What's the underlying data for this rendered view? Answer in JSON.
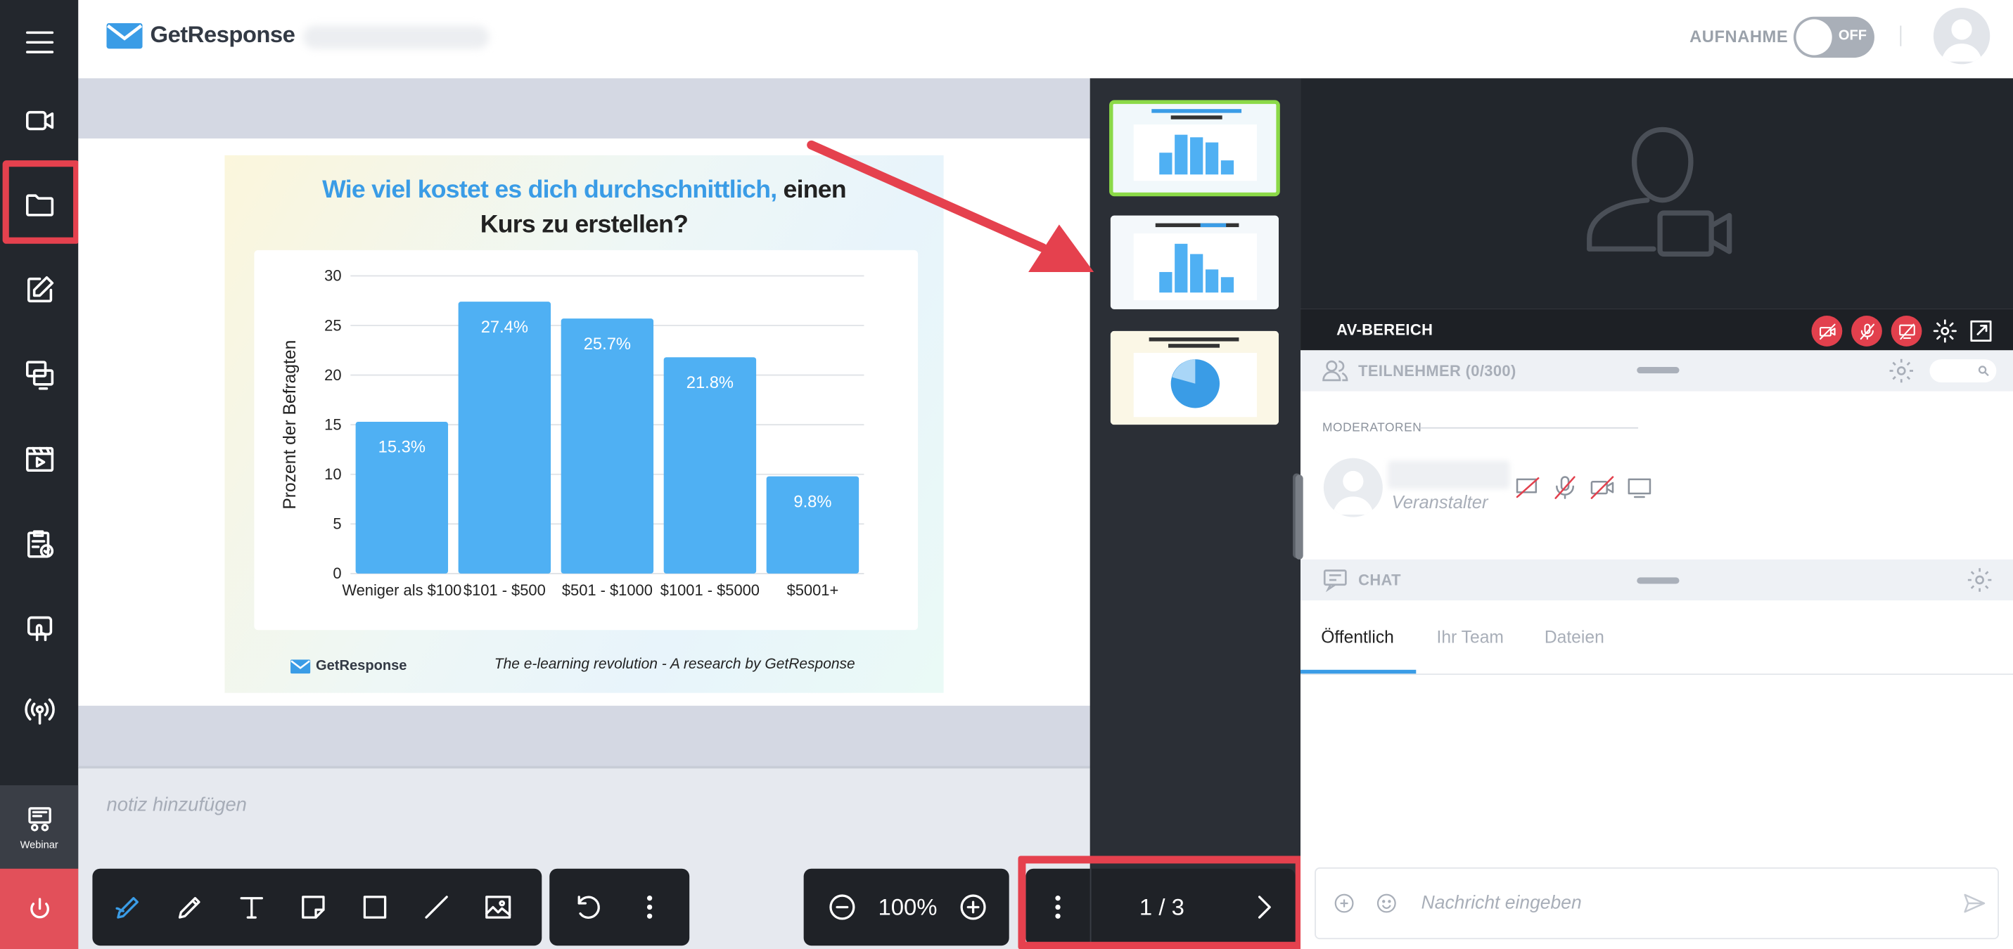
{
  "app": {
    "brand": "GetResponse"
  },
  "header": {
    "recording_label": "AUFNAHME",
    "recording_state": "OFF"
  },
  "sidebar": {
    "items": [
      {
        "name": "menu-icon"
      },
      {
        "name": "camera-icon"
      },
      {
        "name": "folder-icon",
        "highlighted": true
      },
      {
        "name": "edit-icon"
      },
      {
        "name": "screen-share-icon"
      },
      {
        "name": "video-icon"
      },
      {
        "name": "clipboard-check-icon"
      },
      {
        "name": "hand-icon"
      },
      {
        "name": "broadcast-icon"
      }
    ],
    "webinar_label": "Webinar"
  },
  "slide": {
    "title_highlight": "Wie viel kostet es dich durchschnittlich,",
    "title_rest_1": " einen",
    "title_rest_2": "Kurs zu erstellen?",
    "footer_brand": "GetResponse",
    "footer_text": "The e-learning revolution - A research by GetResponse"
  },
  "chart_data": {
    "type": "bar",
    "categories": [
      "Weniger als $100",
      "$101 - $500",
      "$501 - $1000",
      "$1001 - $5000",
      "$5001+"
    ],
    "values": [
      15.3,
      27.4,
      25.7,
      21.8,
      9.8
    ],
    "data_labels": [
      "15.3%",
      "27.4%",
      "25.7%",
      "21.8%",
      "9.8%"
    ],
    "ylabel": "Prozent der Befragten",
    "ylim": [
      0,
      30
    ],
    "yticks": [
      0,
      5,
      10,
      15,
      20,
      25,
      30
    ],
    "grid": true,
    "bar_color": "#4fb0f3"
  },
  "notes": {
    "placeholder": "notiz hinzufügen"
  },
  "toolbar": {
    "zoom": "100%",
    "page": "1 / 3"
  },
  "av": {
    "title": "AV-BEREICH"
  },
  "participants": {
    "title": "TEILNEHMER (0/300)",
    "moderators_label": "MODERATOREN",
    "moderator_role": "Veranstalter"
  },
  "chat": {
    "title": "CHAT",
    "tabs": [
      "Öffentlich",
      "Ihr Team",
      "Dateien"
    ],
    "input_placeholder": "Nachricht eingeben"
  },
  "colors": {
    "accent": "#3a9ce6",
    "highlight_red": "#e5414e",
    "active_thumb": "#8bd948"
  }
}
